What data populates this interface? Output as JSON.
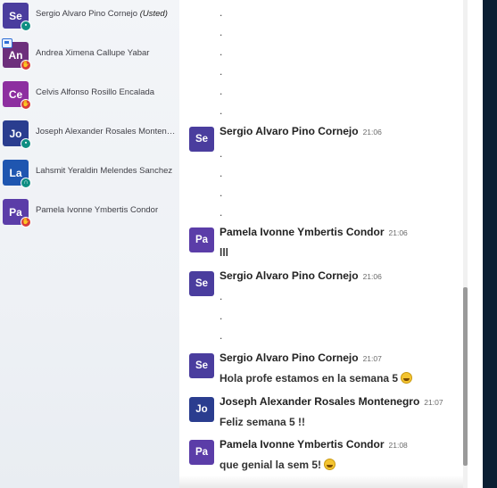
{
  "users": [
    {
      "initials": "Se",
      "name": "Sergio Alvaro Pino Cornejo",
      "suffix": "(Usted)",
      "color": "#4a3d9e",
      "status": "mic-icon"
    },
    {
      "initials": "An",
      "name": "Andrea Ximena Callupe Yabar",
      "suffix": "",
      "color": "#6d2f7c",
      "status": "hand-icon"
    },
    {
      "initials": "Ce",
      "name": "Celvis Alfonso Rosillo Encalada",
      "suffix": "",
      "color": "#8d2fa0",
      "status": "hand-icon"
    },
    {
      "initials": "Jo",
      "name": "Joseph Alexander Rosales Montene…",
      "suffix": "",
      "color": "#2a3d8f",
      "status": "mic-icon"
    },
    {
      "initials": "La",
      "name": "Lahsmit Yeraldin Melendes Sanchez",
      "suffix": "",
      "color": "#1f56b0",
      "status": "headphones-icon"
    },
    {
      "initials": "Pa",
      "name": "Pamela Ivonne Ymbertis Condor",
      "suffix": "",
      "color": "#5b3da8",
      "status": "hand-icon"
    }
  ],
  "top_dots": [
    ".",
    ".",
    ".",
    ".",
    ".",
    "."
  ],
  "messages": [
    {
      "initials": "Se",
      "name": "Sergio Alvaro Pino Cornejo",
      "time": "21:06",
      "color": "#4a3d9e",
      "lines": [
        ".",
        ".",
        ".",
        "."
      ]
    },
    {
      "initials": "Pa",
      "name": "Pamela Ivonne Ymbertis Condor",
      "time": "21:06",
      "color": "#5b3da8",
      "lines": [
        "lll"
      ]
    },
    {
      "initials": "Se",
      "name": "Sergio Alvaro Pino Cornejo",
      "time": "21:06",
      "color": "#4a3d9e",
      "lines": [
        ".",
        ".",
        "."
      ]
    },
    {
      "initials": "Se",
      "name": "Sergio Alvaro Pino Cornejo",
      "time": "21:07",
      "color": "#4a3d9e",
      "lines": [
        "Hola profe estamos en la semana 5"
      ],
      "emoji": "grin-emoji"
    },
    {
      "initials": "Jo",
      "name": "Joseph Alexander Rosales Montenegro",
      "time": "21:07",
      "color": "#2a3d8f",
      "lines": [
        "Feliz semana 5 !!"
      ]
    },
    {
      "initials": "Pa",
      "name": "Pamela Ivonne Ymbertis Condor",
      "time": "21:08",
      "color": "#5b3da8",
      "lines": [
        "que genial la sem 5!"
      ],
      "emoji": "grin-emoji"
    }
  ],
  "theme": {
    "right_panel": "#0b1f33",
    "teal_badge": "#0f8e82",
    "red_badge": "#d93a3a"
  }
}
